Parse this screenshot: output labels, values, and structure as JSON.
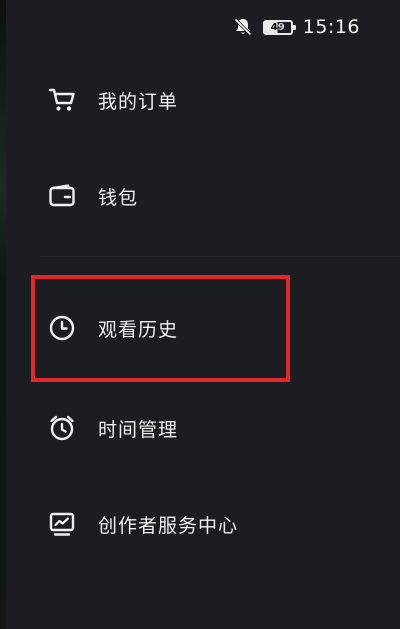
{
  "status_bar": {
    "battery_level": "49",
    "time": "15:16"
  },
  "menu": {
    "items": [
      {
        "label": "我的订单",
        "icon": "cart-icon"
      },
      {
        "label": "钱包",
        "icon": "wallet-icon"
      },
      {
        "label": "观看历史",
        "icon": "clock-icon"
      },
      {
        "label": "时间管理",
        "icon": "alarm-clock-icon"
      },
      {
        "label": "创作者服务中心",
        "icon": "chart-monitor-icon"
      }
    ]
  },
  "colors": {
    "background": "#1b1d23",
    "highlight": "#e3262b",
    "text": "#f0f0f2"
  }
}
